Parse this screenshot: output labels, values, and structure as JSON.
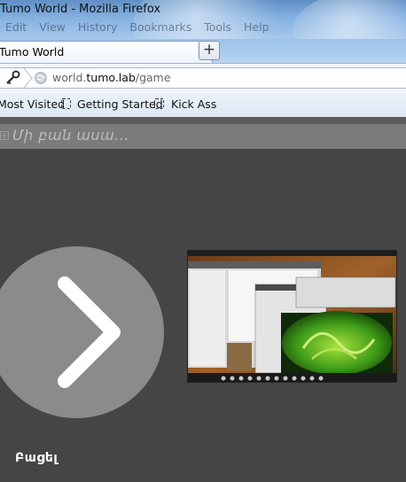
{
  "window": {
    "title": "Tumo World - Mozilla Firefox",
    "menu": [
      "Edit",
      "View",
      "History",
      "Bookmarks",
      "Tools",
      "Help"
    ]
  },
  "tabs": [
    {
      "label": "Tumo World",
      "close": "×"
    }
  ],
  "new_tab_label": "+",
  "address_bar": {
    "prefix": "world.",
    "host": "tumo.lab",
    "path": "/game"
  },
  "bookmarks": [
    {
      "label": "Most Visited"
    },
    {
      "label": "Getting Started"
    },
    {
      "label": "Kick Ass"
    }
  ],
  "chat": {
    "placeholder": "Մի բան ասա..."
  },
  "game": {
    "next_icon": "chevron-right-icon",
    "start_label": "Բացել"
  },
  "colors": {
    "page_bg": "#454545",
    "chat_bar": "#7b7b7b",
    "circle": "#8b8b8b",
    "chevron": "#ffffff"
  }
}
